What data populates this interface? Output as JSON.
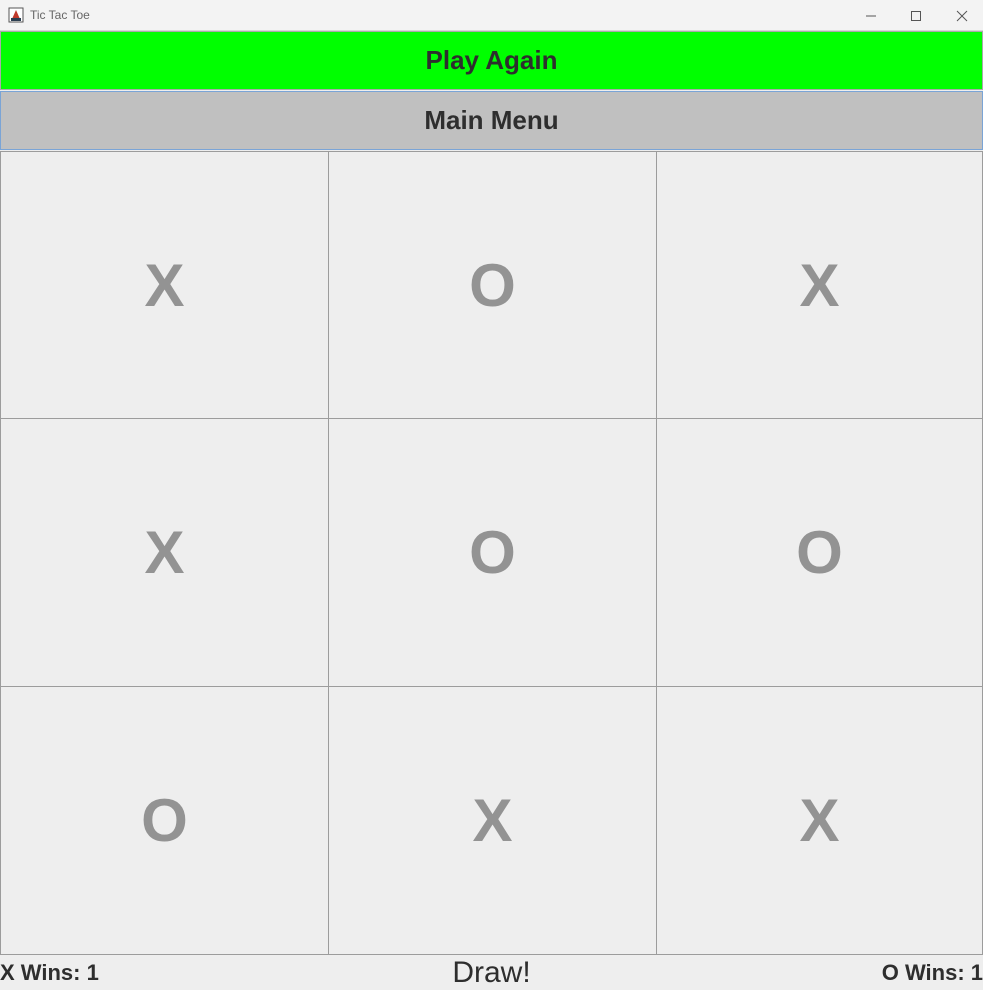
{
  "window": {
    "title": "Tic Tac Toe"
  },
  "buttons": {
    "play_again": "Play Again",
    "main_menu": "Main Menu"
  },
  "board": [
    [
      "X",
      "O",
      "X"
    ],
    [
      "X",
      "O",
      "O"
    ],
    [
      "O",
      "X",
      "X"
    ]
  ],
  "status": {
    "x_wins": "X Wins: 1",
    "result": "Draw!",
    "o_wins": "O Wins: 1"
  },
  "colors": {
    "play_again_bg": "#00ff00",
    "main_menu_bg": "#c0c0c0",
    "mark": "#939393"
  }
}
